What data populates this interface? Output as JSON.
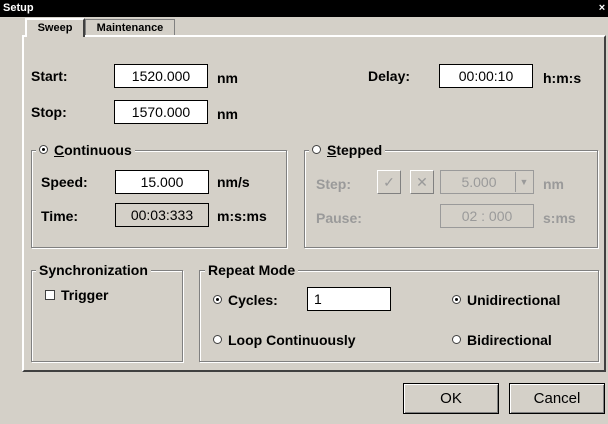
{
  "window": {
    "title": "Setup",
    "close_glyph": "×"
  },
  "tabs": [
    {
      "label": "Sweep",
      "active": true
    },
    {
      "label": "Maintenance",
      "active": false
    }
  ],
  "start": {
    "label": "Start:",
    "value": "1520.000",
    "unit": "nm"
  },
  "stop": {
    "label": "Stop:",
    "value": "1570.000",
    "unit": "nm"
  },
  "delay": {
    "label": "Delay:",
    "value": "00:00:10",
    "unit": "h:m:s"
  },
  "continuous": {
    "label_u": "C",
    "label_rest": "ontinuous",
    "selected": true,
    "speed": {
      "label": "Speed:",
      "value": "15.000",
      "unit": "nm/s"
    },
    "time": {
      "label": "Time:",
      "value": "00:03:333",
      "unit": "m:s:ms"
    }
  },
  "stepped": {
    "label_u": "S",
    "label_rest": "tepped",
    "selected": false,
    "step": {
      "label": "Step:",
      "check_glyph": "✓",
      "x_glyph": "✕",
      "value": "5.000",
      "arrow_glyph": "▼",
      "unit": "nm"
    },
    "pause": {
      "label": "Pause:",
      "value": "02 : 000",
      "unit": "s:ms"
    }
  },
  "sync": {
    "legend": "Synchronization",
    "trigger_label": "Trigger",
    "trigger_checked": false
  },
  "repeat": {
    "legend": "Repeat Mode",
    "cycles_label": "Cycles:",
    "cycles_value": "1",
    "cycles_selected": true,
    "loop_label": "Loop Continuously",
    "loop_selected": false,
    "uni_label": "Unidirectional",
    "uni_selected": true,
    "bi_label": "Bidirectional",
    "bi_selected": false
  },
  "buttons": {
    "ok": "OK",
    "cancel": "Cancel"
  }
}
